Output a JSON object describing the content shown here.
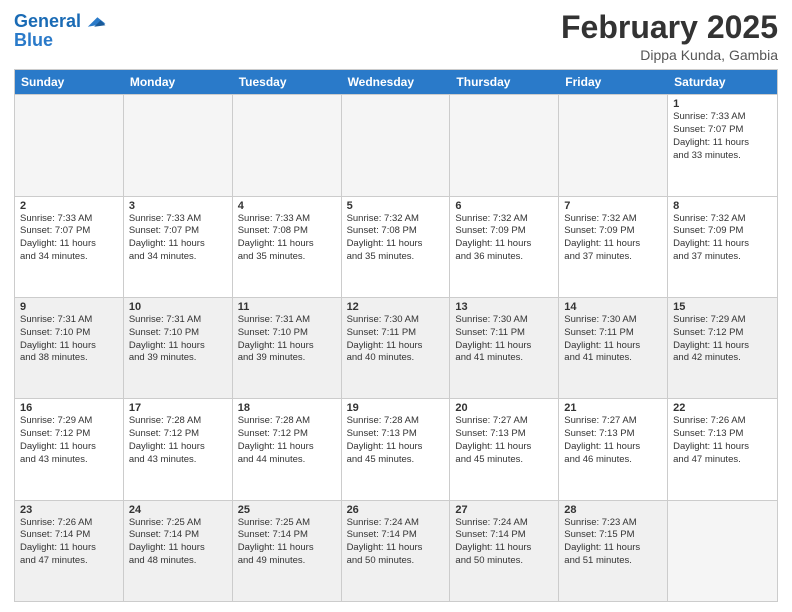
{
  "header": {
    "logo_line1": "General",
    "logo_line2": "Blue",
    "month": "February 2025",
    "location": "Dippa Kunda, Gambia"
  },
  "days_of_week": [
    "Sunday",
    "Monday",
    "Tuesday",
    "Wednesday",
    "Thursday",
    "Friday",
    "Saturday"
  ],
  "weeks": [
    [
      {
        "day": "",
        "info": "",
        "shaded": true
      },
      {
        "day": "",
        "info": "",
        "shaded": true
      },
      {
        "day": "",
        "info": "",
        "shaded": true
      },
      {
        "day": "",
        "info": "",
        "shaded": true
      },
      {
        "day": "",
        "info": "",
        "shaded": true
      },
      {
        "day": "",
        "info": "",
        "shaded": true
      },
      {
        "day": "1",
        "info": "Sunrise: 7:33 AM\nSunset: 7:07 PM\nDaylight: 11 hours\nand 33 minutes.",
        "shaded": false
      }
    ],
    [
      {
        "day": "2",
        "info": "Sunrise: 7:33 AM\nSunset: 7:07 PM\nDaylight: 11 hours\nand 34 minutes.",
        "shaded": false
      },
      {
        "day": "3",
        "info": "Sunrise: 7:33 AM\nSunset: 7:07 PM\nDaylight: 11 hours\nand 34 minutes.",
        "shaded": false
      },
      {
        "day": "4",
        "info": "Sunrise: 7:33 AM\nSunset: 7:08 PM\nDaylight: 11 hours\nand 35 minutes.",
        "shaded": false
      },
      {
        "day": "5",
        "info": "Sunrise: 7:32 AM\nSunset: 7:08 PM\nDaylight: 11 hours\nand 35 minutes.",
        "shaded": false
      },
      {
        "day": "6",
        "info": "Sunrise: 7:32 AM\nSunset: 7:09 PM\nDaylight: 11 hours\nand 36 minutes.",
        "shaded": false
      },
      {
        "day": "7",
        "info": "Sunrise: 7:32 AM\nSunset: 7:09 PM\nDaylight: 11 hours\nand 37 minutes.",
        "shaded": false
      },
      {
        "day": "8",
        "info": "Sunrise: 7:32 AM\nSunset: 7:09 PM\nDaylight: 11 hours\nand 37 minutes.",
        "shaded": false
      }
    ],
    [
      {
        "day": "9",
        "info": "Sunrise: 7:31 AM\nSunset: 7:10 PM\nDaylight: 11 hours\nand 38 minutes.",
        "shaded": true
      },
      {
        "day": "10",
        "info": "Sunrise: 7:31 AM\nSunset: 7:10 PM\nDaylight: 11 hours\nand 39 minutes.",
        "shaded": true
      },
      {
        "day": "11",
        "info": "Sunrise: 7:31 AM\nSunset: 7:10 PM\nDaylight: 11 hours\nand 39 minutes.",
        "shaded": true
      },
      {
        "day": "12",
        "info": "Sunrise: 7:30 AM\nSunset: 7:11 PM\nDaylight: 11 hours\nand 40 minutes.",
        "shaded": true
      },
      {
        "day": "13",
        "info": "Sunrise: 7:30 AM\nSunset: 7:11 PM\nDaylight: 11 hours\nand 41 minutes.",
        "shaded": true
      },
      {
        "day": "14",
        "info": "Sunrise: 7:30 AM\nSunset: 7:11 PM\nDaylight: 11 hours\nand 41 minutes.",
        "shaded": true
      },
      {
        "day": "15",
        "info": "Sunrise: 7:29 AM\nSunset: 7:12 PM\nDaylight: 11 hours\nand 42 minutes.",
        "shaded": true
      }
    ],
    [
      {
        "day": "16",
        "info": "Sunrise: 7:29 AM\nSunset: 7:12 PM\nDaylight: 11 hours\nand 43 minutes.",
        "shaded": false
      },
      {
        "day": "17",
        "info": "Sunrise: 7:28 AM\nSunset: 7:12 PM\nDaylight: 11 hours\nand 43 minutes.",
        "shaded": false
      },
      {
        "day": "18",
        "info": "Sunrise: 7:28 AM\nSunset: 7:12 PM\nDaylight: 11 hours\nand 44 minutes.",
        "shaded": false
      },
      {
        "day": "19",
        "info": "Sunrise: 7:28 AM\nSunset: 7:13 PM\nDaylight: 11 hours\nand 45 minutes.",
        "shaded": false
      },
      {
        "day": "20",
        "info": "Sunrise: 7:27 AM\nSunset: 7:13 PM\nDaylight: 11 hours\nand 45 minutes.",
        "shaded": false
      },
      {
        "day": "21",
        "info": "Sunrise: 7:27 AM\nSunset: 7:13 PM\nDaylight: 11 hours\nand 46 minutes.",
        "shaded": false
      },
      {
        "day": "22",
        "info": "Sunrise: 7:26 AM\nSunset: 7:13 PM\nDaylight: 11 hours\nand 47 minutes.",
        "shaded": false
      }
    ],
    [
      {
        "day": "23",
        "info": "Sunrise: 7:26 AM\nSunset: 7:14 PM\nDaylight: 11 hours\nand 47 minutes.",
        "shaded": true
      },
      {
        "day": "24",
        "info": "Sunrise: 7:25 AM\nSunset: 7:14 PM\nDaylight: 11 hours\nand 48 minutes.",
        "shaded": true
      },
      {
        "day": "25",
        "info": "Sunrise: 7:25 AM\nSunset: 7:14 PM\nDaylight: 11 hours\nand 49 minutes.",
        "shaded": true
      },
      {
        "day": "26",
        "info": "Sunrise: 7:24 AM\nSunset: 7:14 PM\nDaylight: 11 hours\nand 50 minutes.",
        "shaded": true
      },
      {
        "day": "27",
        "info": "Sunrise: 7:24 AM\nSunset: 7:14 PM\nDaylight: 11 hours\nand 50 minutes.",
        "shaded": true
      },
      {
        "day": "28",
        "info": "Sunrise: 7:23 AM\nSunset: 7:15 PM\nDaylight: 11 hours\nand 51 minutes.",
        "shaded": true
      },
      {
        "day": "",
        "info": "",
        "shaded": true
      }
    ]
  ]
}
